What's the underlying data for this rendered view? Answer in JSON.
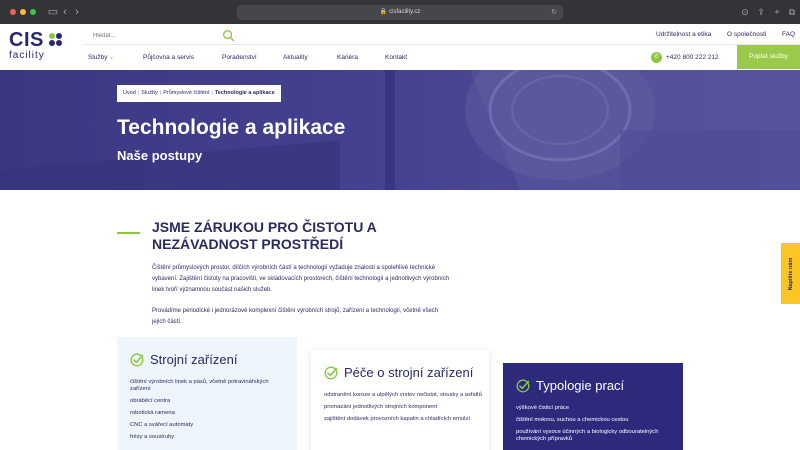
{
  "browser": {
    "url": "cisfacility.cz"
  },
  "logo": {
    "wordmark": "CIS",
    "subtitle": "facility"
  },
  "search": {
    "placeholder": "Hledat..."
  },
  "top_links": [
    "Udržitelnost a etika",
    "O společnosti",
    "FAQ"
  ],
  "nav": {
    "items": [
      "Služby",
      "Půjčovna a servis",
      "Poradenství",
      "Aktuality",
      "Kariéra",
      "Kontakt"
    ],
    "phone": "+420 800 222 212",
    "cta": "Poptat služby"
  },
  "breadcrumb": {
    "items": [
      "Úvod",
      "Služby",
      "Průmyslové čištění",
      "Technologie a aplikace"
    ],
    "separator": "|"
  },
  "hero": {
    "title": "Technologie a aplikace",
    "subtitle": "Naše postupy"
  },
  "intro": {
    "heading_line1": "Jsme zárukou pro čistotu a",
    "heading_line2": "nezávadnost prostředí",
    "para1": "Čištění průmyslových prostor, dílčích výrobních částí a technologií vyžaduje znalosti a spolehlivé technické vybavení. Zajištění čistoty na pracovišti, ve skladovacích prostorech, čištění technologií a jednotlivých výrobních linek tvoří významnou součást našich služeb.",
    "para2": "Provádíme periodické i jednorázové komplexní čištění výrobních strojů, zařízení a technologií, včetně všech jejich částí."
  },
  "cards": [
    {
      "title": "Strojní zařízení",
      "items": [
        "čištění výrobních linek a pásů, včetně potravinářských zařízení",
        "obráběcí centra",
        "robotická ramena",
        "CNC a svářecí automaty",
        "frézy a soustruhy"
      ]
    },
    {
      "title": "Péče o strojní zařízení",
      "items": [
        "odstranění koroze a ulpělých vrstev nečistot, strusky a asfaltů",
        "promazání jednotlivých strojních komponent",
        "zajištění dodávek provozních kapalin a chladících emulzí"
      ]
    },
    {
      "title": "Typologie prací",
      "items": [
        "výškové čisticí práce",
        "čištění mokrou, suchou a chemickou cestou",
        "používání vysoce účinných a biologicky odbouratelných chemických přípravků"
      ]
    }
  ],
  "side_tab": {
    "label": "Napište nám"
  },
  "colors": {
    "brand_navy": "#2b2b60",
    "accent_green": "#8cc63f",
    "hero_overlay": "#3f3c87",
    "card_dark": "#2d2a7e",
    "side_tab": "#fbc524"
  }
}
